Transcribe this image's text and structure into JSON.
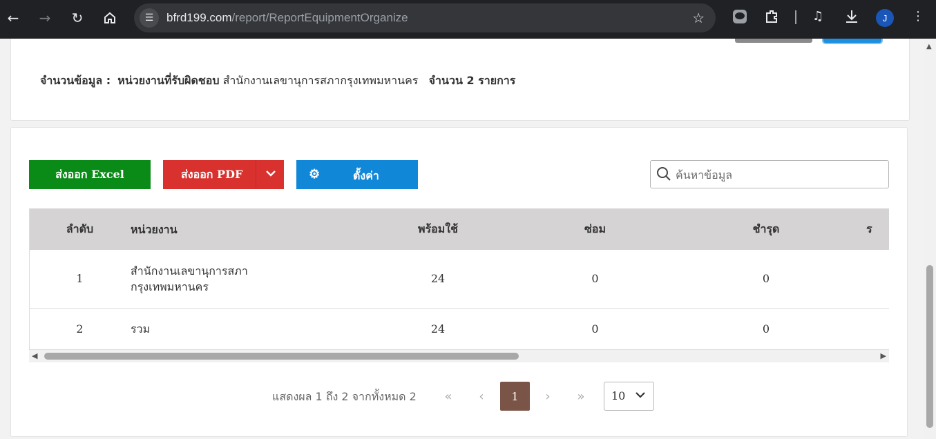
{
  "browser": {
    "url_domain": "bfrd199.com",
    "url_path": "/report/ReportEquipmentOrganize",
    "profile_initial": "J",
    "icons": [
      "back-icon",
      "forward-icon",
      "reload-icon",
      "home-icon",
      "site-settings-icon",
      "bookmark-star-icon",
      "line-extension-icon",
      "extensions-icon",
      "media-controls-icon",
      "download-icon",
      "avatar",
      "kebab-menu-icon"
    ]
  },
  "summary": {
    "count_label": "จำนวนข้อมูล :",
    "unit_label": "หน่วยงานที่รับผิดชอบ",
    "unit_value": "สำนักงานเลขานุการสภากรุงเทพมหานคร",
    "total_label": "จำนวน 2 รายการ"
  },
  "toolbar": {
    "excel_label": "ส่งออก Excel",
    "pdf_label": "ส่งออก PDF",
    "settings_label": "ตั้งค่า",
    "search_placeholder": "ค้นหาข้อมูล"
  },
  "table": {
    "headers": [
      "ลำดับ",
      "หน่วยงาน",
      "พร้อมใช้",
      "ซ่อม",
      "ชำรุด",
      "ร"
    ],
    "rows": [
      {
        "no": "1",
        "unit": "สำนักงานเลขานุการสภากรุงเทพมหานคร",
        "ready": "24",
        "repair": "0",
        "damaged": "0"
      },
      {
        "no": "2",
        "unit": "รวม",
        "ready": "24",
        "repair": "0",
        "damaged": "0"
      }
    ]
  },
  "pagination": {
    "info": "แสดงผล 1 ถึง 2 จากทั้งหมด 2",
    "current_page": "1",
    "page_size": "10"
  }
}
